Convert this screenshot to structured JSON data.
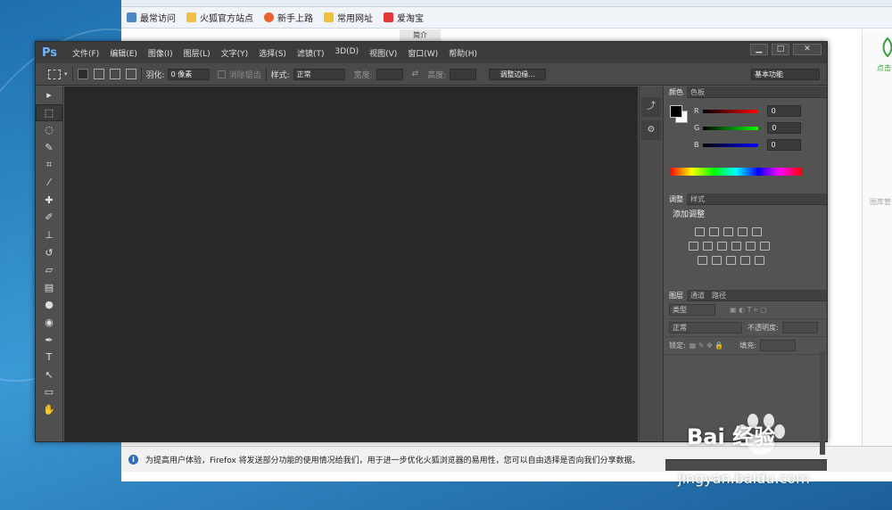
{
  "bookmarks": [
    {
      "label": "最常访问",
      "color": "#4a86c8"
    },
    {
      "label": "火狐官方站点",
      "color": "#f0c040"
    },
    {
      "label": "新手上路",
      "color": "#e8632b"
    },
    {
      "label": "常用网址",
      "color": "#f0c040"
    },
    {
      "label": "爱淘宝",
      "color": "#e43838"
    }
  ],
  "browser": {
    "tab_fragment": "简介",
    "right_panel_text": "点击",
    "right_panel_sub": "图库管",
    "notification": "为提高用户体验，Firefox 将发送部分功能的使用情况给我们，用于进一步优化火狐浏览器的易用性，您可以自由选择是否向我们分享数据。"
  },
  "ps": {
    "logo": "Ps",
    "menu": [
      "文件(F)",
      "编辑(E)",
      "图像(I)",
      "图层(L)",
      "文字(Y)",
      "选择(S)",
      "滤镜(T)",
      "3D(D)",
      "视图(V)",
      "窗口(W)",
      "帮助(H)"
    ],
    "window_buttons": {
      "minimize": "▁",
      "maximize": "□",
      "close": "✕"
    },
    "options": {
      "feather_label": "羽化:",
      "feather_value": "0 像素",
      "antialias_label": "消除锯齿",
      "style_label": "样式:",
      "style_value": "正常",
      "width_label": "宽度:",
      "height_label": "高度:",
      "refine_edge": "调整边缘...",
      "workspace": "基本功能"
    },
    "color_panel": {
      "tabs": [
        "颜色",
        "色板"
      ],
      "r_label": "R",
      "g_label": "G",
      "b_label": "B",
      "r_value": "0",
      "g_value": "0",
      "b_value": "0"
    },
    "adjust_panel": {
      "tabs": [
        "调整",
        "样式"
      ],
      "title": "添加调整"
    },
    "layers_panel": {
      "tabs": [
        "图层",
        "通道",
        "路径"
      ],
      "kind": "类型",
      "blend": "正常",
      "opacity_label": "不透明度:",
      "lock_label": "锁定:",
      "fill_label": "填充:"
    }
  },
  "watermark": {
    "brand": "Bai 经验",
    "url": "jingyan.baidu.com"
  }
}
